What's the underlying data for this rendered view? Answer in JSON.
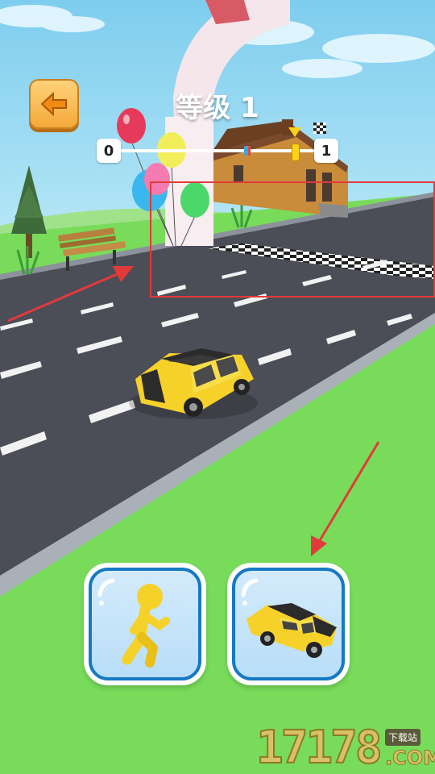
{
  "header": {
    "back_icon": "arrow-left-icon",
    "level_title": "等级 1"
  },
  "progress": {
    "current_level": "0",
    "next_level": "1",
    "player_position": 0.9,
    "finish_icon": "checkered-flag-icon"
  },
  "choices": [
    {
      "name": "runner",
      "icon": "yellow-stickman-icon"
    },
    {
      "name": "car",
      "icon": "yellow-car-icon"
    }
  ],
  "watermark": {
    "digits": "17178",
    "badge": "下载站",
    "domain": ".COM"
  },
  "colors": {
    "sky": "#8fd3f0",
    "grass": "#78dc5a",
    "road": "#4b4d57",
    "car": "#f5d12a",
    "button_border": "#1679c4",
    "highlight_box": "#e23a3a"
  }
}
